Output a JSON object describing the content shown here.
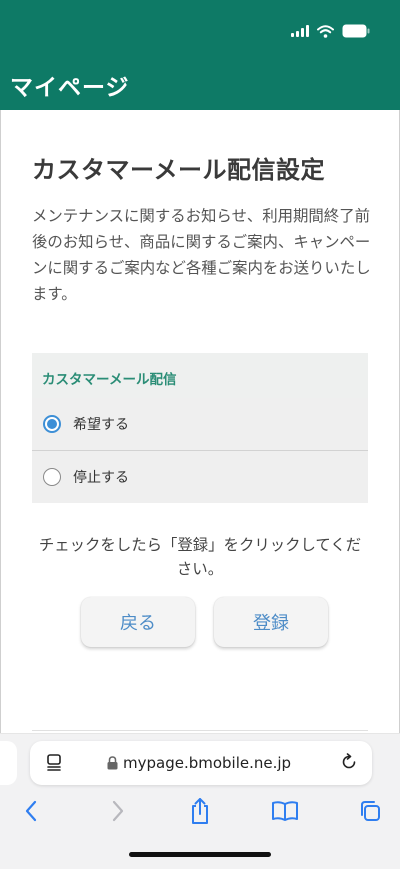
{
  "header": {
    "title": "マイページ",
    "background_color": "#0e7a66"
  },
  "status_bar": {
    "icons": [
      "cellular-signal-icon",
      "wifi-icon",
      "battery-icon"
    ]
  },
  "main": {
    "title": "カスタマーメール配信設定",
    "description": "メンテナンスに関するお知らせ、利用期間終了前後のお知らせ、商品に関するご案内、キャンペーンに関するご案内など各種ご案内をお送りいたします。",
    "option_panel": {
      "title": "カスタマーメール配信",
      "options": [
        {
          "label": "希望する",
          "checked": true
        },
        {
          "label": "停止する",
          "checked": false
        }
      ]
    },
    "instruction": "チェックをしたら「登録」をクリックしてください。",
    "buttons": {
      "back": "戻る",
      "register": "登録"
    }
  },
  "browser": {
    "url": "mypage.bmobile.ne.jp",
    "toolbar": [
      "back-icon",
      "forward-icon",
      "share-icon",
      "bookmarks-icon",
      "tabs-icon"
    ]
  },
  "colors": {
    "brand_green": "#0e7a66",
    "accent_blue": "#3d8fd6",
    "button_text": "#4d8cc7"
  }
}
